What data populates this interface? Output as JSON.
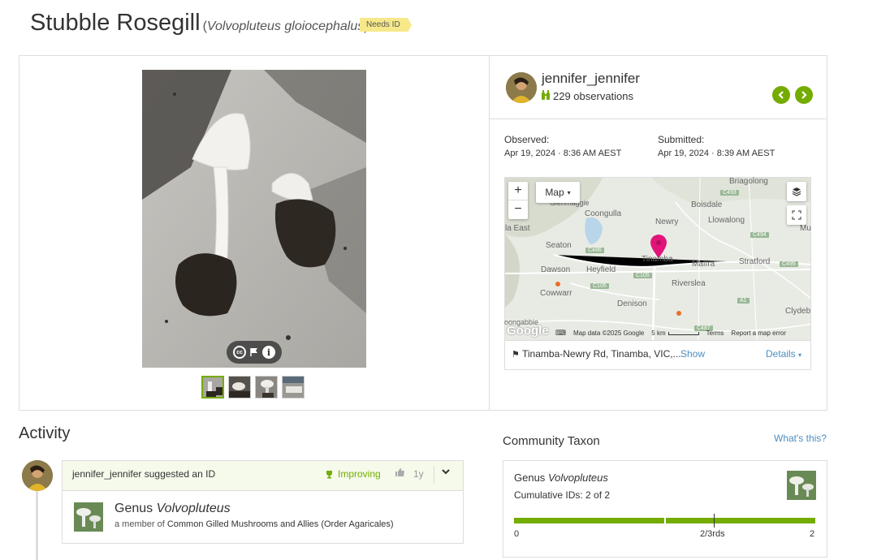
{
  "header": {
    "common_name": "Stubble Rosegill",
    "scientific_name": "Volvopluteus gloiocephalus",
    "status_badge": "Needs ID"
  },
  "photo": {
    "thumbnail_count": 4,
    "controls": {
      "license": "cc-icon",
      "flag": "flag-icon",
      "info": "info-icon"
    }
  },
  "observer": {
    "username": "jennifer_jennifer",
    "observations": "229 observations"
  },
  "dates": {
    "observed_label": "Observed:",
    "observed_value": "Apr 19, 2024 · 8:36 AM AEST",
    "submitted_label": "Submitted:",
    "submitted_value": "Apr 19, 2024 · 8:39 AM AEST"
  },
  "map": {
    "type_label": "Map",
    "zoom_in": "+",
    "zoom_out": "−",
    "places": [
      "Briagolong",
      "Boisdale",
      "Coongulla",
      "Newry",
      "Llowalong",
      "Seaton",
      "Tinamba",
      "Maffra",
      "Stratford",
      "Dawson",
      "Heyfield",
      "Riverslea",
      "Cowwarr",
      "Denison",
      "Clydeb",
      "Glenmaggie",
      "Mu",
      "la East",
      "oongabbie"
    ],
    "roads": [
      "C493",
      "C486",
      "C494",
      "C105",
      "C105",
      "C495",
      "A1",
      "C487"
    ],
    "attribution": {
      "google": "Google",
      "data": "Map data ©2025 Google",
      "scale": "5 km",
      "terms": "Terms",
      "report": "Report a map error"
    },
    "pin_color": "#e2147a",
    "location_text": "Tinamba-Newry Rd, Tinamba, VIC,...",
    "show_label": "Show",
    "details_label": "Details"
  },
  "activity": {
    "heading": "Activity",
    "entry": {
      "user": "jennifer_jennifer",
      "action": " suggested an ID",
      "status": "Improving",
      "age": "1y",
      "taxon_rank": "Genus",
      "taxon_name": "Volvopluteus",
      "member_prefix": "a member of ",
      "member_of": "Common Gilled Mushrooms and Allies (Order Agaricales)"
    }
  },
  "community_taxon": {
    "heading": "Community Taxon",
    "whats_this": "What's this?",
    "taxon_rank": "Genus",
    "taxon_name": "Volvopluteus",
    "cumulative": "Cumulative IDs: 2 of 2",
    "bar_min": "0",
    "bar_mid": "2/3rds",
    "bar_max": "2",
    "progress_fraction": 1.0
  },
  "colors": {
    "accent": "#74ac00",
    "link": "#4d8ec1",
    "badge": "#f7e98a"
  }
}
